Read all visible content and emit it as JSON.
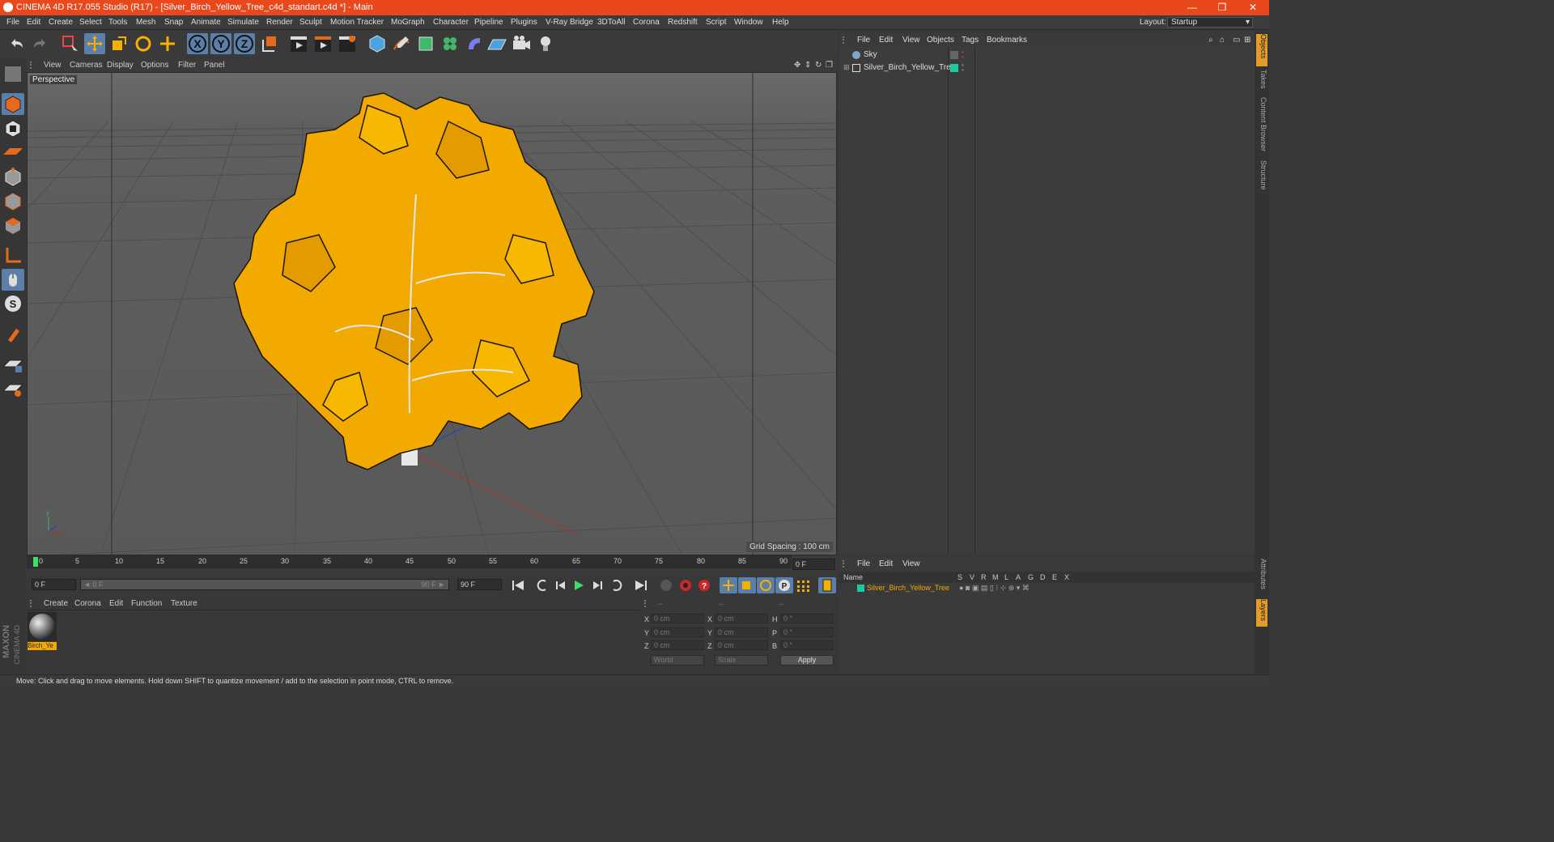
{
  "window": {
    "title": "CINEMA 4D R17.055 Studio (R17) - [Silver_Birch_Yellow_Tree_c4d_standart.c4d *] - Main",
    "minimize_glyph": "—",
    "maximize_glyph": "❐",
    "close_glyph": "✕",
    "accent_color": "#e8481c"
  },
  "menubar": {
    "items": [
      "File",
      "Edit",
      "Create",
      "Select",
      "Tools",
      "Mesh",
      "Snap",
      "Animate",
      "Simulate",
      "Render",
      "Sculpt",
      "Motion Tracker",
      "MoGraph",
      "Character",
      "Pipeline",
      "Plugins",
      "V-Ray Bridge",
      "3DToAll",
      "Corona",
      "Redshift",
      "Script",
      "Window",
      "Help"
    ],
    "layout_label": "Layout:",
    "layout_value": "Startup"
  },
  "viewport": {
    "menu": [
      "View",
      "Cameras",
      "Display",
      "Options",
      "Filter",
      "Panel"
    ],
    "label": "Perspective",
    "grid_spacing": "Grid Spacing : 100 cm",
    "tree_leaf_color": "#f2a900",
    "trunk_color": "#e8e8e8"
  },
  "timeline": {
    "ticks": [
      "0",
      "5",
      "10",
      "15",
      "20",
      "25",
      "30",
      "35",
      "40",
      "45",
      "50",
      "55",
      "60",
      "65",
      "70",
      "75",
      "80",
      "85",
      "90"
    ],
    "current_frame": "0 F",
    "start_field": "0 F",
    "range_start": "◄ 0 F",
    "range_end": "90 F ►",
    "end_field": "90 F"
  },
  "material_manager": {
    "menu": [
      "Create",
      "Corona",
      "Edit",
      "Function",
      "Texture"
    ],
    "material_name": "Birch_Ye"
  },
  "coordinates": {
    "header": [
      "--",
      "--",
      "--"
    ],
    "rows": [
      {
        "a": "X",
        "av": "0 cm",
        "b": "X",
        "bv": "0 cm",
        "c": "H",
        "cv": "0 °"
      },
      {
        "a": "Y",
        "av": "0 cm",
        "b": "Y",
        "bv": "0 cm",
        "c": "P",
        "cv": "0 °"
      },
      {
        "a": "Z",
        "av": "0 cm",
        "b": "Z",
        "bv": "0 cm",
        "c": "B",
        "cv": "0 °"
      }
    ],
    "world_dropdown": "World",
    "scale_dropdown": "Scale",
    "apply": "Apply"
  },
  "object_manager": {
    "menu": [
      "File",
      "Edit",
      "View",
      "Objects",
      "Tags",
      "Bookmarks"
    ],
    "objects": [
      {
        "name": "Sky"
      },
      {
        "name": "Silver_Birch_Yellow_Tree",
        "tag_color": "#1ec8a0"
      }
    ]
  },
  "layer_manager": {
    "menu": [
      "File",
      "Edit",
      "View"
    ],
    "columns": [
      "Name",
      "S",
      "V",
      "R",
      "M",
      "L",
      "A",
      "G",
      "D",
      "E",
      "X"
    ],
    "layers": [
      {
        "name": "Silver_Birch_Yellow_Tree",
        "color": "#1ec8a0"
      }
    ]
  },
  "right_tabs": [
    "Objects",
    "Takes",
    "Content Browser",
    "Structure",
    "Attributes",
    "Layers"
  ],
  "branding": {
    "maxon": "MAXON",
    "cinema": "CINEMA 4D"
  },
  "status": "Move: Click and drag to move elements. Hold down SHIFT to quantize movement / add to the selection in point mode, CTRL to remove."
}
